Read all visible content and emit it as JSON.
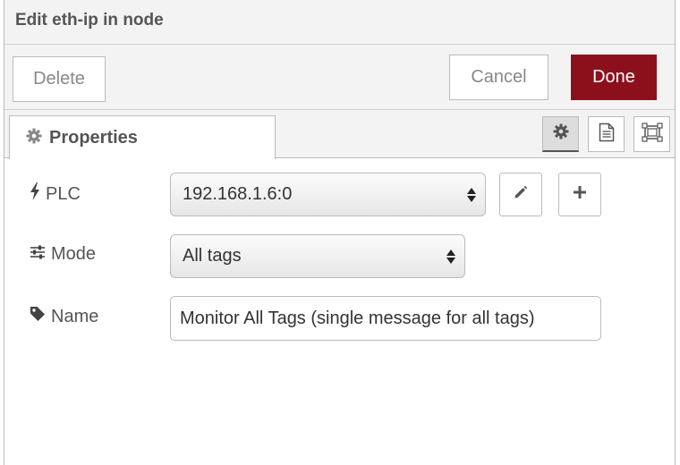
{
  "dialog": {
    "title": "Edit eth-ip in node"
  },
  "toolbar": {
    "delete_label": "Delete",
    "cancel_label": "Cancel",
    "done_label": "Done"
  },
  "tabs": [
    {
      "label": "Properties",
      "icon": "gear-icon"
    }
  ],
  "tab_icons": [
    "gear-icon",
    "description-icon",
    "appearance-icon"
  ],
  "form": {
    "plc": {
      "label": "PLC",
      "icon": "bolt-icon",
      "value": "192.168.1.6:0"
    },
    "mode": {
      "label": "Mode",
      "icon": "sliders-icon",
      "value": "All tags"
    },
    "name": {
      "label": "Name",
      "icon": "tag-icon",
      "value": "Monitor All Tags (single message for all tags)"
    }
  },
  "colors": {
    "accent": "#8c101c",
    "chrome": "#f3f3f3",
    "border": "#bbbbbb"
  }
}
